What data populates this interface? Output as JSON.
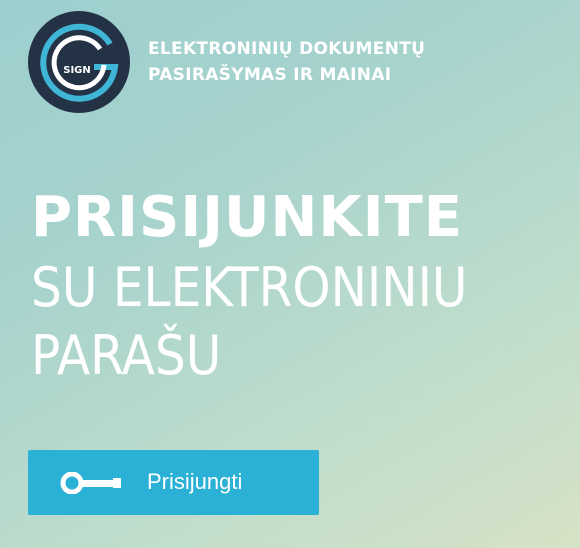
{
  "logo": {
    "text": "SIGN",
    "colors": {
      "dark": "#243246",
      "accent": "#3fb6d6",
      "light": "#ffffff"
    }
  },
  "brand": {
    "line1": "ELEKTRONINIŲ DOKUMENTŲ",
    "line2": "PASIRAŠYMAS IR MAINAI"
  },
  "headline": {
    "line1": "PRISIJUNKITE",
    "line2": "SU ELEKTRONINIU",
    "line3": "PARAŠU"
  },
  "login_button": {
    "label": "Prisijungti",
    "icon": "key-icon",
    "color": "#2bb0d6"
  }
}
